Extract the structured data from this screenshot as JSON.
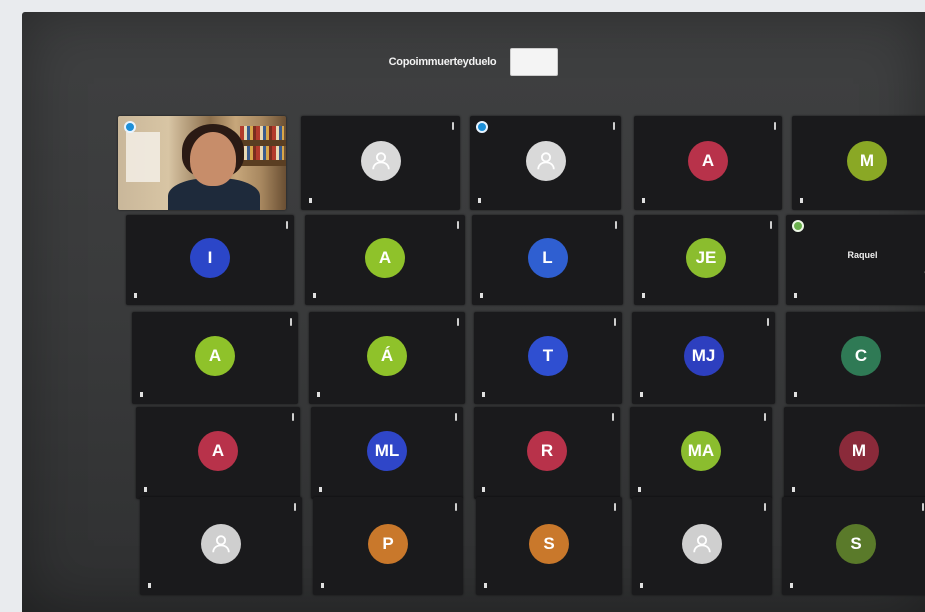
{
  "meeting": {
    "title": "Copoimmuerteyduelo"
  },
  "tiles": [
    {
      "kind": "video",
      "status": ""
    },
    {
      "kind": "person",
      "status": "Ⓐ",
      "color": "#d9d9d9"
    },
    {
      "kind": "person",
      "status": "",
      "color": "#d9d9d9",
      "speaker": "blue"
    },
    {
      "kind": "initials",
      "initials": "A",
      "color": "#b8324a"
    },
    {
      "kind": "initials",
      "initials": "M",
      "color": "#8aa825"
    },
    {
      "kind": "initials",
      "initials": "I",
      "color": "#2b46c8"
    },
    {
      "kind": "initials",
      "initials": "A",
      "color": "#8fc22a"
    },
    {
      "kind": "initials",
      "initials": "L",
      "color": "#2f5fd1"
    },
    {
      "kind": "initials",
      "initials": "JE",
      "color": "#8bbd2e"
    },
    {
      "kind": "name",
      "name": "Raquel",
      "speaker": "green"
    },
    {
      "kind": "initials",
      "initials": "A",
      "color": "#8fc22a"
    },
    {
      "kind": "initials",
      "initials": "Á",
      "color": "#8fc22a"
    },
    {
      "kind": "initials",
      "initials": "T",
      "color": "#2f4fd1"
    },
    {
      "kind": "initials",
      "initials": "MJ",
      "color": "#2d3fbf"
    },
    {
      "kind": "initials",
      "initials": "C",
      "color": "#2f7a55"
    },
    {
      "kind": "initials",
      "initials": "A",
      "color": "#b8324a"
    },
    {
      "kind": "initials",
      "initials": "ML",
      "color": "#2f46c8"
    },
    {
      "kind": "initials",
      "initials": "R",
      "color": "#b8324a"
    },
    {
      "kind": "initials",
      "initials": "MA",
      "color": "#8bbd2e"
    },
    {
      "kind": "initials",
      "initials": "M",
      "color": "#8a2a3a"
    },
    {
      "kind": "person",
      "color": "#cfcfcf"
    },
    {
      "kind": "initials",
      "initials": "P",
      "color": "#c9782b"
    },
    {
      "kind": "initials",
      "initials": "S",
      "color": "#c9782b"
    },
    {
      "kind": "person",
      "color": "#cfcfcf"
    },
    {
      "kind": "initials",
      "initials": "S",
      "color": "#5a7a2a"
    }
  ]
}
